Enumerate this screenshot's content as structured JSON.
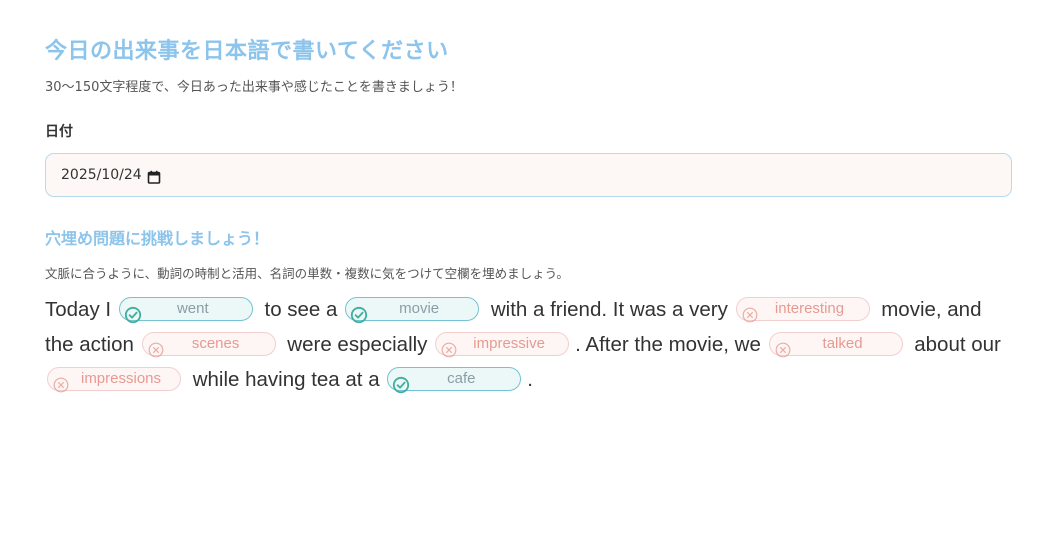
{
  "header": {
    "title": "今日の出来事を日本語で書いてください",
    "subtitle": "30～150文字程度で、今日あった出来事や感じたことを書きましょう！"
  },
  "date": {
    "label": "日付",
    "value": "2025/10/24"
  },
  "exercise": {
    "title": "穴埋め問題に挑戦しましょう！",
    "instruction": "文脈に合うように、動詞の時制と活用、名詞の単数・複数に気をつけて空欄を埋めましょう。",
    "segments": [
      {
        "type": "text",
        "text": "Today I "
      },
      {
        "type": "blank",
        "answer": "went",
        "status": "correct"
      },
      {
        "type": "text",
        "text": " to see a "
      },
      {
        "type": "blank",
        "answer": "movie",
        "status": "correct"
      },
      {
        "type": "text",
        "text": " with a friend. It was a very "
      },
      {
        "type": "blank",
        "answer": "interesting",
        "status": "incorrect"
      },
      {
        "type": "text",
        "text": " movie, and the action "
      },
      {
        "type": "blank",
        "answer": "scenes",
        "status": "incorrect"
      },
      {
        "type": "text",
        "text": " were especially "
      },
      {
        "type": "blank",
        "answer": "impressive",
        "status": "incorrect"
      },
      {
        "type": "text",
        "text": ". After the movie, we "
      },
      {
        "type": "blank",
        "answer": "talked",
        "status": "incorrect"
      },
      {
        "type": "text",
        "text": " about our "
      },
      {
        "type": "blank",
        "answer": "impressions",
        "status": "incorrect"
      },
      {
        "type": "text",
        "text": " while having tea at a "
      },
      {
        "type": "blank",
        "answer": "cafe",
        "status": "correct"
      },
      {
        "type": "text",
        "text": "."
      }
    ]
  },
  "colors": {
    "accent": "#8cc4ec",
    "correct_border": "#74c3d4",
    "correct_icon": "#3fae9c",
    "incorrect_border": "#f2cfcf",
    "incorrect_text": "#e79a92"
  },
  "icons": {
    "date": "calendar-icon",
    "correct": "check-circle-icon",
    "incorrect": "x-circle-icon"
  }
}
